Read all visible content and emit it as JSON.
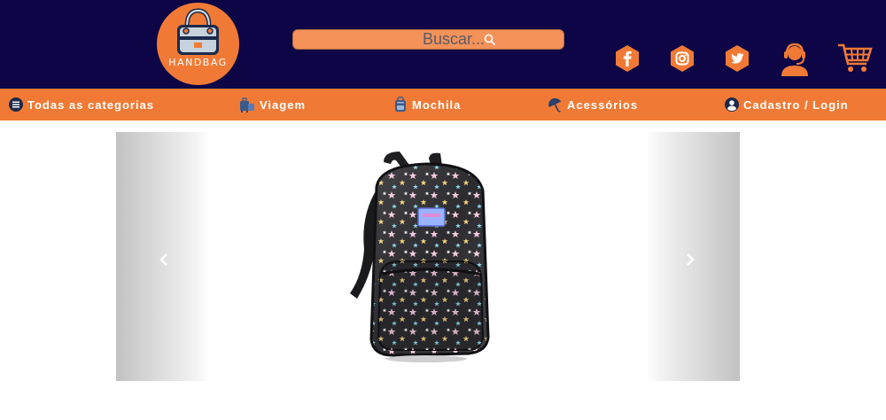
{
  "brand": {
    "logo_text": "HANDBAG"
  },
  "search": {
    "placeholder": "Buscar..."
  },
  "social": {
    "icons": [
      "facebook-icon",
      "instagram-icon",
      "twitter-icon"
    ]
  },
  "colors": {
    "header_bg": "#0d0546",
    "accent": "#f07a35",
    "search_bg": "#f4925a"
  },
  "nav": {
    "all_categories": "Todas as categorias",
    "travel": "Viagem",
    "backpack": "Mochila",
    "accessories": "Acessórios",
    "account": "Cadastro / Login"
  }
}
